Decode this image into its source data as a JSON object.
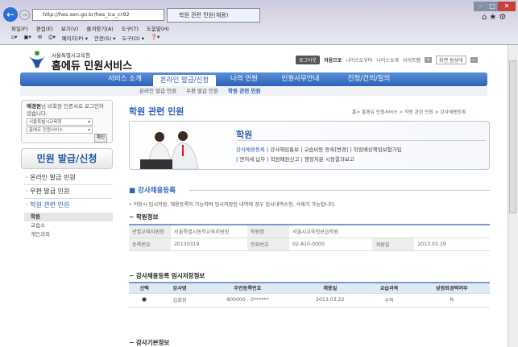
{
  "browser": {
    "url": "http://hes.sen.go.kr/hes_ica_cr92",
    "tab_title": "학원 관련 민원(채용)",
    "menu": [
      "파일(F)",
      "편집(E)",
      "보기(V)",
      "즐겨찾기(A)",
      "도구(T)",
      "도움말(H)"
    ],
    "toolbar": [
      "페이지(P) ▾",
      "안전(S) ▾",
      "도구(O) ▾"
    ]
  },
  "header": {
    "org": "서울특별시교육청",
    "site_title": "홈에듀 민원서비스",
    "logout": "로그아웃",
    "links": [
      "처음으로",
      "나이스도우미",
      "나이스소개",
      "사이트맵"
    ],
    "screen_size": "화면 원상태"
  },
  "nav": {
    "items": [
      "서비스 소개",
      "온라인 발급/신청",
      "나의 민원",
      "민원사무안내",
      "진정/건의/질의"
    ],
    "sub": [
      "온라인 발급 민원",
      "우편 발급 민원",
      "학원 관련 민원"
    ]
  },
  "sidebar": {
    "login_user": "예경원",
    "login_msg": "님 비회원 인증서로 로그인하셨습니다.",
    "select1": "서울특별시교육청",
    "select2": "홈에듀 민원서비스",
    "confirm": "확인",
    "big_button": "민원 발급/신청",
    "menu": [
      "· 온라인 발급 민원",
      "· 우편 발급 민원",
      "· 학원 관련 민원"
    ],
    "sub": [
      "학원",
      "교습소",
      "개인과외"
    ]
  },
  "main": {
    "title": "학원 관련 민원",
    "breadcrumb": "홈> 홈에듀 민원서비스 > 학원 관련 민원 > 강사채용등록",
    "banner": {
      "title": "학원",
      "links": [
        "강사채용등록",
        "강사해임통보",
        "교습비등 등록[변경]",
        "학원배상책임보험가입",
        "면허세 납부",
        "학원폐원신고",
        "행정처분 시정결과보고"
      ]
    },
    "section_title": "강사채용등록",
    "note": "• 저장시 임시저장, 채용등록이 가능하며 임시저장된 내역에 경우 임시내역수정, 삭제가 가능합니다.",
    "academy": {
      "heading": "학원정보",
      "labels": [
        "관할교육지원청",
        "학원명",
        "등록번호",
        "전화번호",
        "개원일"
      ],
      "values": [
        "서울특별시동작교육지원청",
        "서울시교육청보습학원",
        "20130319",
        "02-810-0000",
        "2013.03.19"
      ]
    },
    "temp": {
      "heading": "강사채용등록 임시저장정보",
      "columns": [
        "선택",
        "강사명",
        "주민등록번호",
        "채용일",
        "교습과목",
        "성범죄경력여부"
      ],
      "rows": [
        [
          "김희정",
          "800000 - 0******",
          "2013.03.22",
          "수학",
          "N"
        ]
      ]
    },
    "basic": {
      "heading": "강사기본정보"
    }
  }
}
